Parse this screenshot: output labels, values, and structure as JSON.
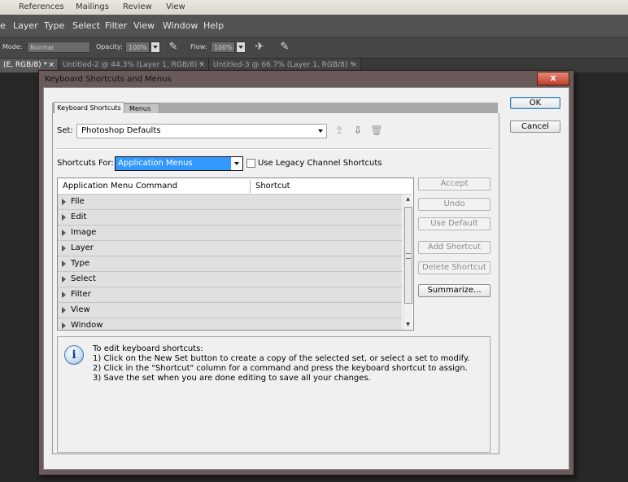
{
  "word_ribbon": {
    "tabs": [
      "References",
      "Mailings",
      "Review",
      "View"
    ]
  },
  "menubar": {
    "items": [
      "e",
      "Layer",
      "Type",
      "Select",
      "Filter",
      "View",
      "Window",
      "Help"
    ]
  },
  "options_bar": {
    "mode_label": "Mode:",
    "mode_value": "Normal",
    "opacity_label": "Opacity:",
    "opacity_value": "100%",
    "flow_label": "Flow:",
    "flow_value": "100%"
  },
  "doc_tabs": [
    {
      "label": "(E, RGB/8) *",
      "close": "×"
    },
    {
      "label": "Untitled-2 @ 44.3% (Layer 1, RGB/8) *",
      "close": "×"
    },
    {
      "label": "Untitled-3 @ 66.7% (Layer 1, RGB/8) *",
      "close": "×"
    }
  ],
  "dialog": {
    "title": "Keyboard Shortcuts and Menus",
    "close_glyph": "x",
    "ok_label": "OK",
    "cancel_label": "Cancel",
    "tabs": [
      "Keyboard Shortcuts",
      "Menus"
    ],
    "set_label": "Set:",
    "set_value": "Photoshop Defaults",
    "shortcuts_for_label": "Shortcuts For:",
    "shortcuts_for_value": "Application Menus",
    "legacy_label": "Use Legacy Channel Shortcuts",
    "table": {
      "columns": [
        "Application Menu Command",
        "Shortcut"
      ],
      "rows": [
        "File",
        "Edit",
        "Image",
        "Layer",
        "Type",
        "Select",
        "Filter",
        "View",
        "Window"
      ]
    },
    "side_buttons": {
      "accept": "Accept",
      "undo": "Undo",
      "use_default": "Use Default",
      "add_shortcut": "Add Shortcut",
      "delete_shortcut": "Delete Shortcut",
      "summarize": "Summarize..."
    },
    "info": {
      "icon_glyph": "i",
      "lines": [
        "To edit keyboard shortcuts:",
        "1) Click on the New Set button to create a copy of the selected set, or select a set to modify.",
        "2) Click in the \"Shortcut\" column for a command and press the keyboard shortcut to assign.",
        "3) Save the set when you are done editing to save all your changes."
      ]
    }
  }
}
